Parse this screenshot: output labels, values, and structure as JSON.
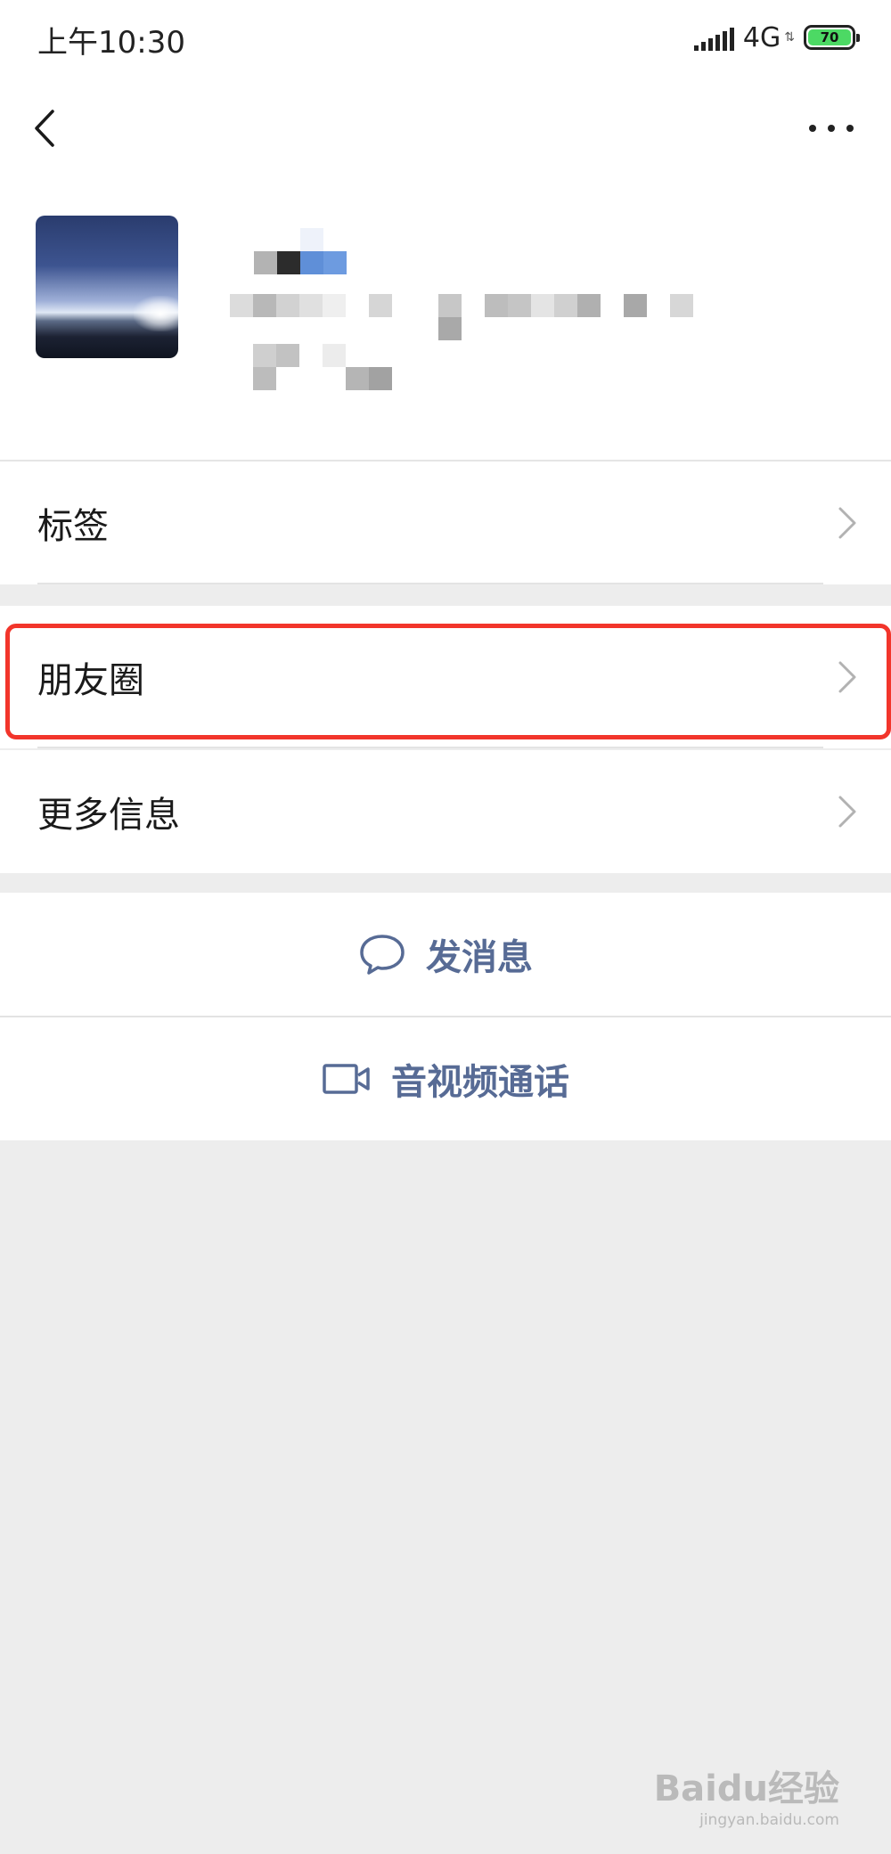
{
  "status_bar": {
    "time": "上午10:30",
    "network": "4G",
    "battery": "70"
  },
  "nav": {
    "back_icon": "chevron-left-icon",
    "more_icon": "more-dots-icon"
  },
  "menu": {
    "tags_label": "标签",
    "moments_label": "朋友圈",
    "more_info_label": "更多信息"
  },
  "actions": {
    "message_label": "发消息",
    "video_call_label": "音视频通话"
  },
  "watermark": {
    "brand": "Baidu经验",
    "site": "jingyan.baidu.com"
  },
  "colors": {
    "link_blue": "#576b95",
    "highlight_red": "#f2352b",
    "background": "#ededed",
    "battery_green": "#4cd964"
  }
}
